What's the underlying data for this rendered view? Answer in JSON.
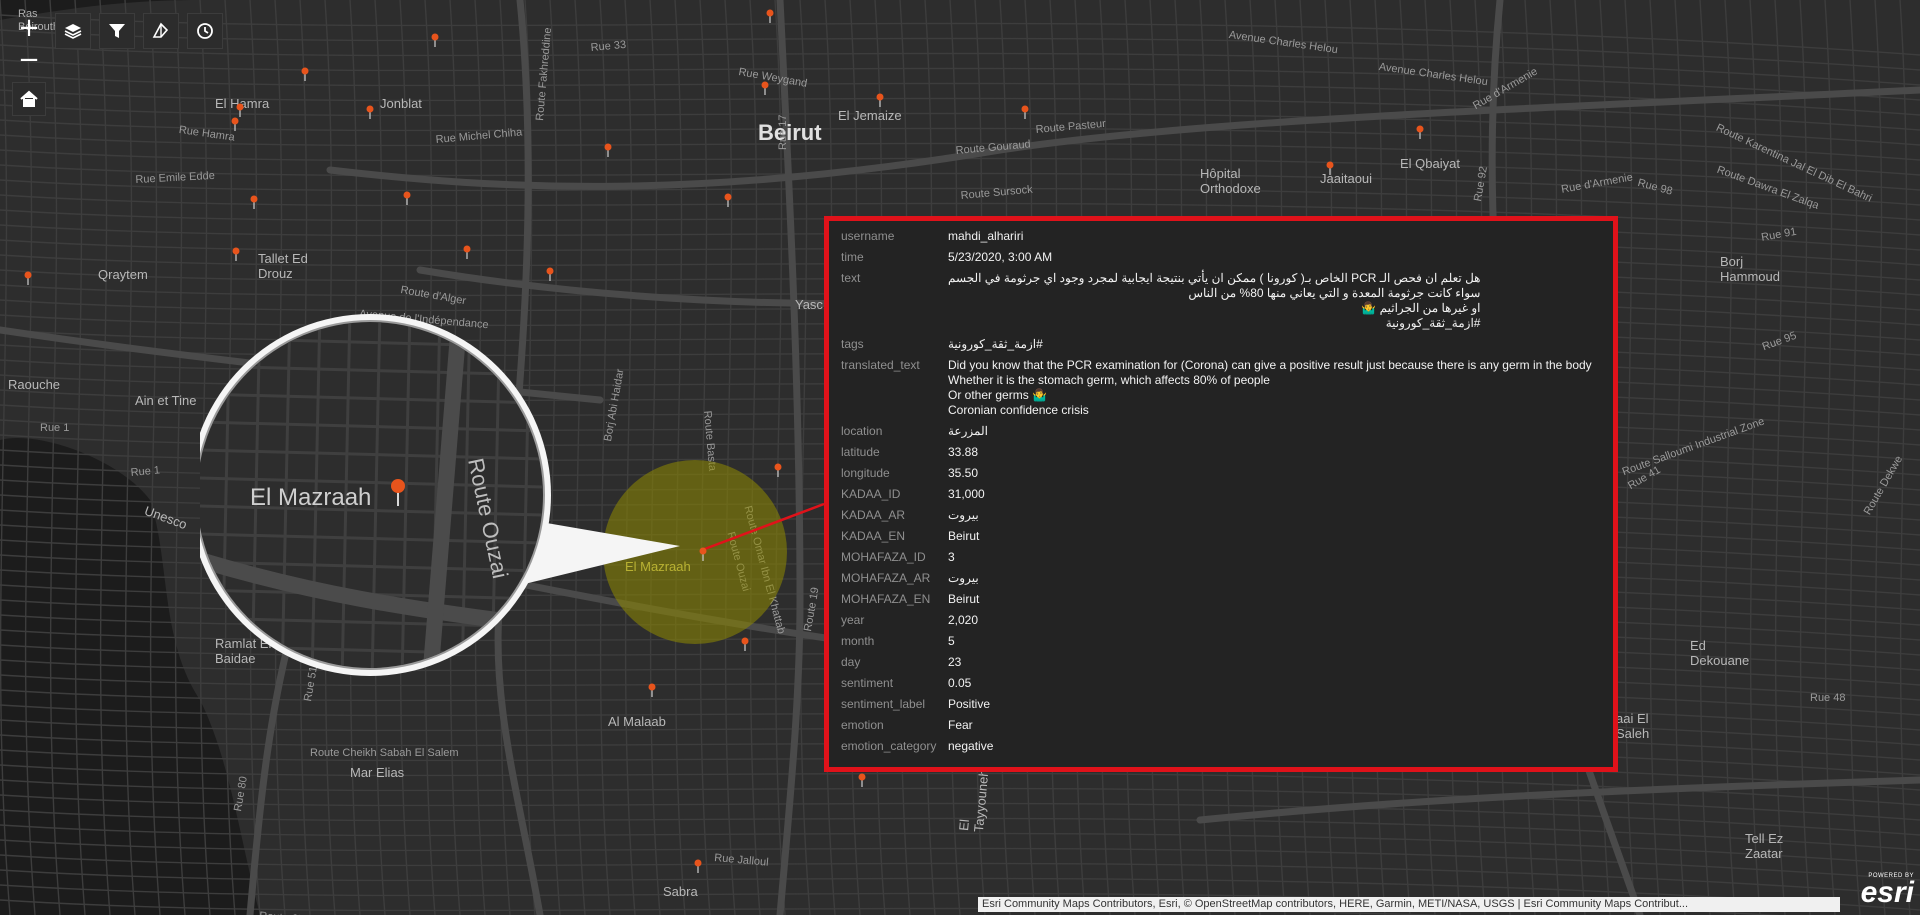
{
  "map": {
    "labels": [
      {
        "text": "Ras\nBeirouth",
        "kind": "small"
      },
      {
        "text": "Rue 33",
        "kind": "road"
      },
      {
        "text": "Avenue Charles Helou",
        "kind": "road"
      },
      {
        "text": "Rue Weygand",
        "kind": "road"
      },
      {
        "text": "Avenue Charles Helou",
        "kind": "road"
      },
      {
        "text": "El Hamra",
        "kind": "place"
      },
      {
        "text": "Jonblat",
        "kind": "place"
      },
      {
        "text": "El Jemaize",
        "kind": "place"
      },
      {
        "text": "Beirut",
        "kind": "city"
      },
      {
        "text": "Route Karentina Jal El Dib El Bahri",
        "kind": "road"
      },
      {
        "text": "Rue d'Armenie",
        "kind": "road"
      },
      {
        "text": "Rue Hamra",
        "kind": "road"
      },
      {
        "text": "Rue Michel Chiha",
        "kind": "road"
      },
      {
        "text": "Route Pasteur",
        "kind": "road"
      },
      {
        "text": "Route Gouraud",
        "kind": "road"
      },
      {
        "text": "Rue Emile Edde",
        "kind": "road"
      },
      {
        "text": "El Qbaiyat",
        "kind": "place"
      },
      {
        "text": "Route Dawra El Zalqa",
        "kind": "road"
      },
      {
        "text": "Rue 98",
        "kind": "road"
      },
      {
        "text": "Hôpital\nOrthodoxe",
        "kind": "place"
      },
      {
        "text": "Jaaitaoui",
        "kind": "place"
      },
      {
        "text": "Rue d'Armenie",
        "kind": "road"
      },
      {
        "text": "Route Sursock",
        "kind": "road"
      },
      {
        "text": "Tallet Ed\nDrouz",
        "kind": "place"
      },
      {
        "text": "Qraytem",
        "kind": "place"
      },
      {
        "text": "Route d'Alger",
        "kind": "road"
      },
      {
        "text": "Avenue de l'Indépendance",
        "kind": "road"
      },
      {
        "text": "Yasc",
        "kind": "place"
      },
      {
        "text": "Rue 91",
        "kind": "road"
      },
      {
        "text": "Borj\nHammoud",
        "kind": "place"
      },
      {
        "text": "Rue 95",
        "kind": "road"
      },
      {
        "text": "Raouche",
        "kind": "place"
      },
      {
        "text": "Ain et Tine",
        "kind": "place"
      },
      {
        "text": "Rue 1",
        "kind": "road"
      },
      {
        "text": "Rue 1",
        "kind": "road"
      },
      {
        "text": "Unesco",
        "kind": "place"
      },
      {
        "text": "Route Salloumi Industrial Zone",
        "kind": "road"
      },
      {
        "text": "Rue 41",
        "kind": "road"
      },
      {
        "text": "Route Dekwe",
        "kind": "road"
      },
      {
        "text": "El Mazraah",
        "kind": "highlight"
      },
      {
        "text": "Route Omar Ibn El Khattab",
        "kind": "road"
      },
      {
        "text": "Route Ouzai",
        "kind": "road"
      },
      {
        "text": "Route 19",
        "kind": "road"
      },
      {
        "text": "Ramlat El\nBaidae",
        "kind": "place"
      },
      {
        "text": "Al Malaab",
        "kind": "place"
      },
      {
        "text": "Ed\nDekouane",
        "kind": "place"
      },
      {
        "text": "Rue 48",
        "kind": "road"
      },
      {
        "text": "aai El\nSaleh",
        "kind": "place"
      },
      {
        "text": "Mar Elias",
        "kind": "place"
      },
      {
        "text": "Route Cheikh Sabah El Salem",
        "kind": "road"
      },
      {
        "text": "Rue 80",
        "kind": "road"
      },
      {
        "text": "El\nTayyouneh",
        "kind": "place"
      },
      {
        "text": "Tell Ez\nZaatar",
        "kind": "place"
      },
      {
        "text": "Rue Jalloul",
        "kind": "road"
      },
      {
        "text": "Sabra",
        "kind": "place"
      },
      {
        "text": "Route 65",
        "kind": "road"
      },
      {
        "text": "Rue 51",
        "kind": "road"
      },
      {
        "text": "Route Basta",
        "kind": "road"
      },
      {
        "text": "Borj Abi Haidar",
        "kind": "road"
      },
      {
        "text": "Route Fakhreddine",
        "kind": "road"
      },
      {
        "text": "Rue 17",
        "kind": "road"
      },
      {
        "text": "Rue 92",
        "kind": "road"
      }
    ],
    "magnifier": {
      "labels": [
        "El Mazraah",
        "Route Omar Ibn El Khattab",
        "Route Ouzai"
      ]
    }
  },
  "toolbar": {
    "zoom_in_label": "+",
    "zoom_out_label": "−",
    "home_icon": "home-icon",
    "layers_icon": "layers-icon",
    "filter_icon": "filter-icon",
    "measure_icon": "measure-icon",
    "time_icon": "clock-icon"
  },
  "popup": {
    "rows": [
      {
        "key": "username",
        "value": "mahdi_alhariri",
        "rtl": false
      },
      {
        "key": "time",
        "value": "5/23/2020, 3:00 AM",
        "rtl": false
      },
      {
        "key": "text",
        "value": "هل تعلم ان فحص الـ PCR الخاص بـ( كورونا ) ممكن ان يأتي بنتيجة ايجابية لمجرد وجود اي جرثومة في الجسم\nسواء كانت جرثومة المعدة و التي يعاني منها 80% من الناس\nاو غيرها من الجراثيم 🤷‍♂️\n#ازمة_ثقة_كورونية",
        "rtl": true
      },
      {
        "key": "tags",
        "value": "#ازمة_ثقة_كورونية",
        "rtl": true
      },
      {
        "key": "translated_text",
        "value": "Did you know that the PCR examination for (Corona) can give a positive result just because there is any germ in the body\nWhether it is the stomach germ, which affects 80% of people\nOr other germs 🤷‍♂️\nCoronian confidence crisis",
        "rtl": false
      },
      {
        "key": "location",
        "value": "المزرعة",
        "rtl": true
      },
      {
        "key": "latitude",
        "value": "33.88",
        "rtl": false
      },
      {
        "key": "longitude",
        "value": "35.50",
        "rtl": false
      },
      {
        "key": "KADAA_ID",
        "value": "31,000",
        "rtl": false
      },
      {
        "key": "KADAA_AR",
        "value": "بيروت",
        "rtl": true
      },
      {
        "key": "KADAA_EN",
        "value": "Beirut",
        "rtl": false
      },
      {
        "key": "MOHAFAZA_ID",
        "value": "3",
        "rtl": false
      },
      {
        "key": "MOHAFAZA_AR",
        "value": "بيروت",
        "rtl": true
      },
      {
        "key": "MOHAFAZA_EN",
        "value": "Beirut",
        "rtl": false
      },
      {
        "key": "year",
        "value": "2,020",
        "rtl": false
      },
      {
        "key": "month",
        "value": "5",
        "rtl": false
      },
      {
        "key": "day",
        "value": "23",
        "rtl": false
      },
      {
        "key": "sentiment",
        "value": "0.05",
        "rtl": false
      },
      {
        "key": "sentiment_label",
        "value": "Positive",
        "rtl": false
      },
      {
        "key": "emotion",
        "value": "Fear",
        "rtl": false
      },
      {
        "key": "emotion_category",
        "value": "negative",
        "rtl": false
      }
    ]
  },
  "attribution": "Esri Community Maps Contributors, Esri, © OpenStreetMap contributors, HERE, Garmin, METI/NASA, USGS | Esri Community Maps Contribut...",
  "esri": {
    "powered_by": "POWERED BY",
    "brand": "esri"
  },
  "colors": {
    "accent_red": "#e0121a",
    "highlight_yellow": "#c8c000",
    "pin": "#e8541c"
  }
}
